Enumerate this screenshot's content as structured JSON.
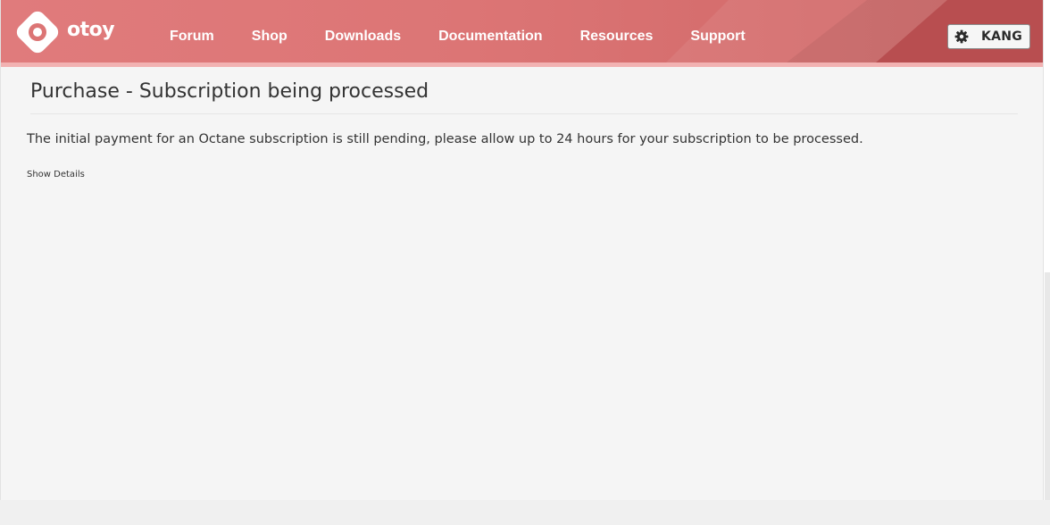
{
  "header": {
    "logo_text": "otoy",
    "nav": [
      {
        "label": "Forum"
      },
      {
        "label": "Shop"
      },
      {
        "label": "Downloads"
      },
      {
        "label": "Documentation"
      },
      {
        "label": "Resources"
      },
      {
        "label": "Support"
      }
    ],
    "user": {
      "name": "KANG",
      "icon": "gear-icon"
    },
    "colors": {
      "brand": "#dc7575",
      "brand_dark": "#b84e50",
      "stripe": "#f2b2b2"
    }
  },
  "main": {
    "title": "Purchase - Subscription being processed",
    "message": "The initial payment for an Octane subscription is still pending, please allow up to 24 hours for your subscription to be processed.",
    "details_link": "Show Details"
  }
}
